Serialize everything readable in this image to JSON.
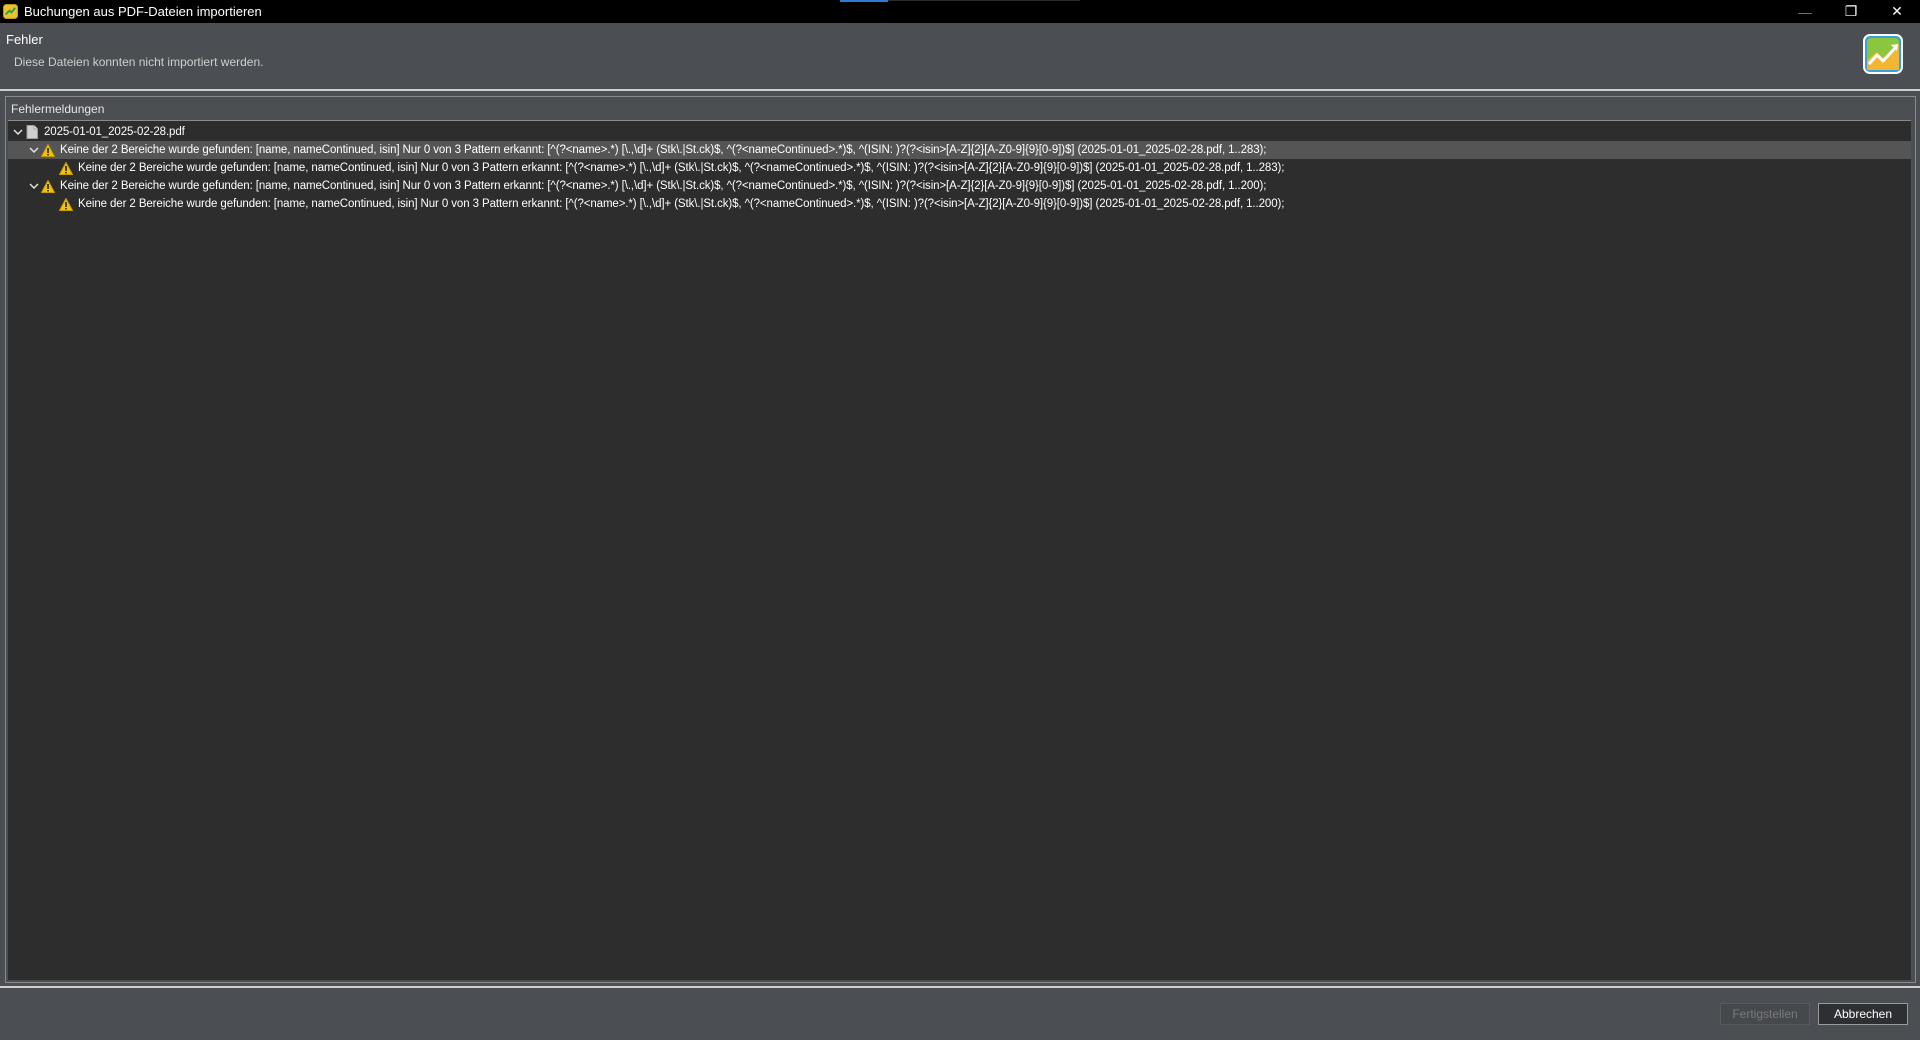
{
  "window": {
    "title": "Buchungen aus PDF-Dateien importieren",
    "controls": {
      "minimize": "—",
      "restore": "❐",
      "close": "✕"
    }
  },
  "header": {
    "title": "Fehler",
    "description": "Diese Dateien konnten nicht importiert werden.",
    "logo_icon": "portfolio-performance-logo"
  },
  "group": {
    "legend": "Fehlermeldungen"
  },
  "tree": {
    "rows": [
      {
        "level": 0,
        "expanded": true,
        "icon": "file-icon",
        "text": "2025-01-01_2025-02-28.pdf"
      },
      {
        "level": 1,
        "expanded": true,
        "selected": true,
        "icon": "warning-icon",
        "text": "Keine der 2 Bereiche wurde gefunden: [name, nameContinued, isin] Nur 0 von 3 Pattern erkannt: [^(?<name>.*) [\\.,\\d]+ (Stk\\.|St.ck)$, ^(?<nameContinued>.*)$, ^(ISIN: )?(?<isin>[A-Z]{2}[A-Z0-9]{9}[0-9])$] (2025-01-01_2025-02-28.pdf, 1..283);"
      },
      {
        "level": 2,
        "icon": "warning-icon",
        "text": "Keine der 2 Bereiche wurde gefunden: [name, nameContinued, isin] Nur 0 von 3 Pattern erkannt: [^(?<name>.*) [\\.,\\d]+ (Stk\\.|St.ck)$, ^(?<nameContinued>.*)$, ^(ISIN: )?(?<isin>[A-Z]{2}[A-Z0-9]{9}[0-9])$] (2025-01-01_2025-02-28.pdf, 1..283);"
      },
      {
        "level": 1,
        "expanded": true,
        "icon": "warning-icon",
        "text": "Keine der 2 Bereiche wurde gefunden: [name, nameContinued, isin] Nur 0 von 3 Pattern erkannt: [^(?<name>.*) [\\.,\\d]+ (Stk\\.|St.ck)$, ^(?<nameContinued>.*)$, ^(ISIN: )?(?<isin>[A-Z]{2}[A-Z0-9]{9}[0-9])$] (2025-01-01_2025-02-28.pdf, 1..200);"
      },
      {
        "level": 2,
        "icon": "warning-icon",
        "text": "Keine der 2 Bereiche wurde gefunden: [name, nameContinued, isin] Nur 0 von 3 Pattern erkannt: [^(?<name>.*) [\\.,\\d]+ (Stk\\.|St.ck)$, ^(?<nameContinued>.*)$, ^(ISIN: )?(?<isin>[A-Z]{2}[A-Z0-9]{9}[0-9])$] (2025-01-01_2025-02-28.pdf, 1..200);"
      }
    ]
  },
  "footer": {
    "finish_label": "Fertigstellen",
    "finish_enabled": false,
    "cancel_label": "Abbrechen"
  },
  "colors": {
    "warning": "#f5c400",
    "selected_row": "#555555",
    "tree_background": "#2d2d2d",
    "dialog_background": "#4b4e52"
  }
}
